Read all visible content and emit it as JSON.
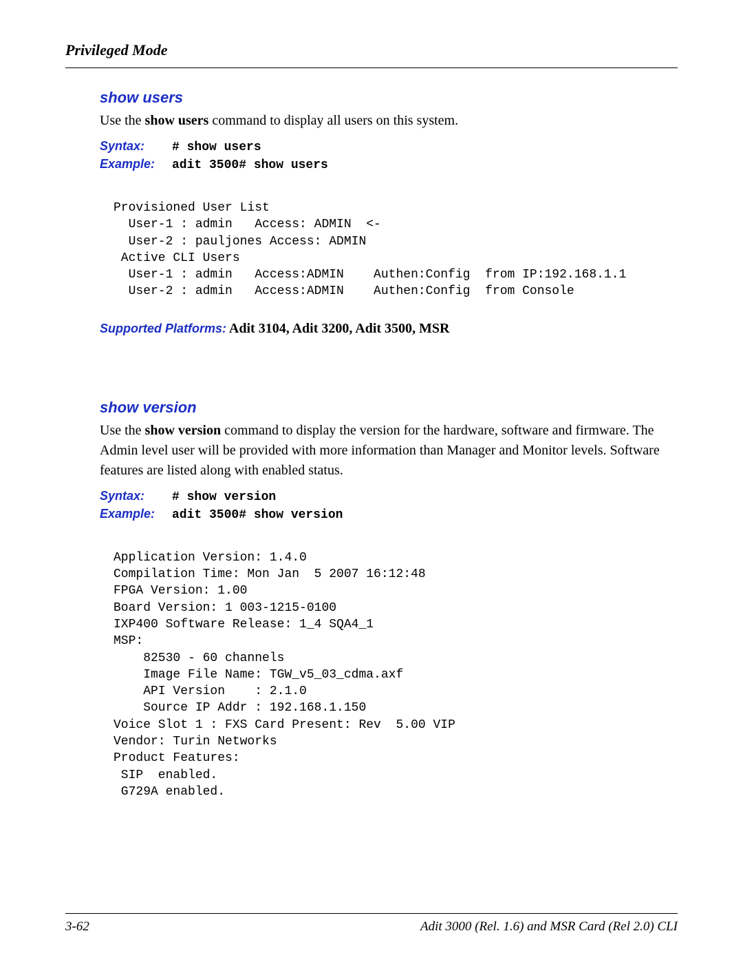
{
  "header": {
    "title": "Privileged Mode"
  },
  "sections": {
    "show_users": {
      "heading": "show users",
      "desc_pre": "Use the ",
      "desc_bold": "show users",
      "desc_post": " command to display all users on this system.",
      "syntax_label": "Syntax:",
      "syntax_value": "# show users",
      "example_label": "Example:",
      "example_value": "adit 3500# show users",
      "output": "Provisioned User List\n  User-1 : admin   Access: ADMIN  <-\n  User-2 : pauljones Access: ADMIN\n Active CLI Users\n  User-1 : admin   Access:ADMIN    Authen:Config  from IP:192.168.1.1\n  User-2 : admin   Access:ADMIN    Authen:Config  from Console",
      "supported_label": "Supported Platforms:",
      "supported_value": "  Adit 3104, Adit 3200, Adit 3500, MSR"
    },
    "show_version": {
      "heading": "show version",
      "desc_pre": "Use the ",
      "desc_bold": "show version",
      "desc_post": " command to display the version for the hardware, software and firmware. The Admin level user will be provided with more information than Manager and Monitor levels. Software features are listed along with enabled status.",
      "syntax_label": "Syntax:",
      "syntax_value": "# show version",
      "example_label": "Example:",
      "example_value": "adit 3500# show version",
      "output": "Application Version: 1.4.0\nCompilation Time: Mon Jan  5 2007 16:12:48\nFPGA Version: 1.00\nBoard Version: 1 003-1215-0100\nIXP400 Software Release: 1_4 SQA4_1\nMSP:\n    82530 - 60 channels\n    Image File Name: TGW_v5_03_cdma.axf\n    API Version    : 2.1.0\n    Source IP Addr : 192.168.1.150\nVoice Slot 1 : FXS Card Present: Rev  5.00 VIP\nVendor: Turin Networks\nProduct Features:\n SIP  enabled.\n G729A enabled."
    }
  },
  "footer": {
    "page": "3-62",
    "doc": "Adit 3000 (Rel. 1.6) and MSR Card (Rel 2.0) CLI"
  }
}
